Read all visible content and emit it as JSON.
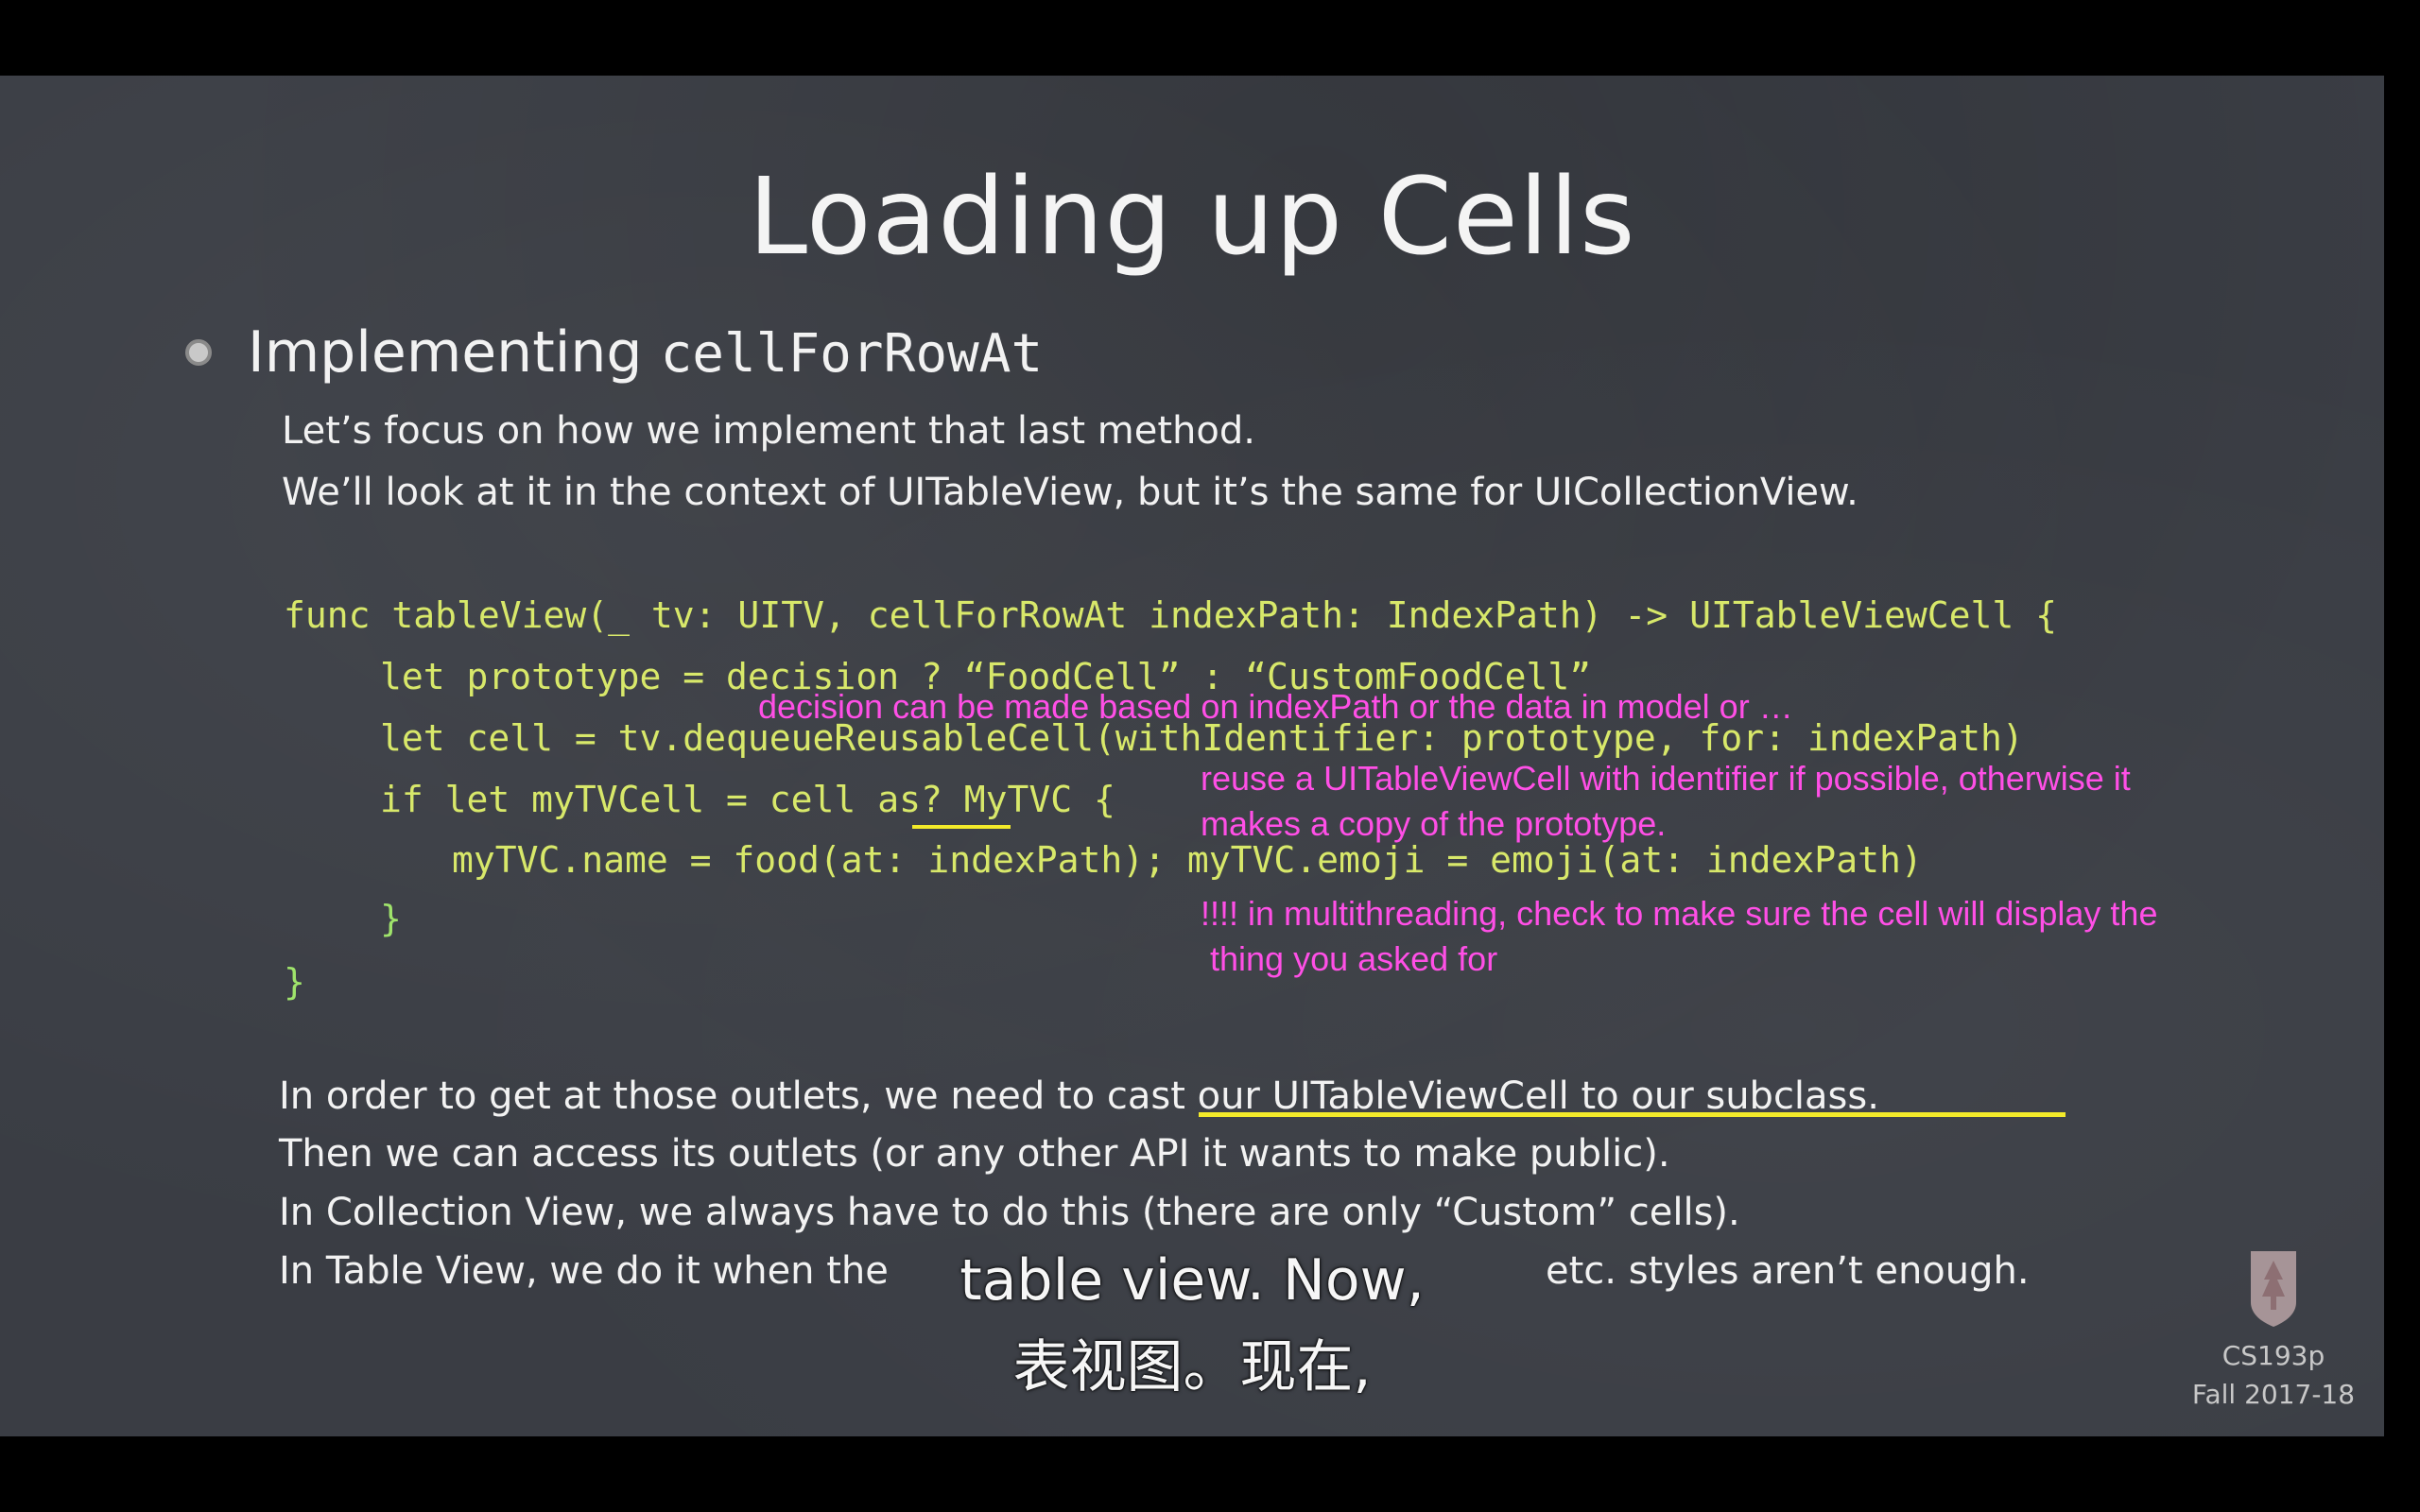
{
  "slide": {
    "title": "Loading up Cells",
    "bullet": {
      "label": "Implementing",
      "code": "cellForRowAt"
    },
    "intro": [
      "Let’s focus on how we implement that last method.",
      "We’ll look at it in the context of UITableView, but it’s the same for UICollectionView."
    ],
    "code": {
      "line1": "func tableView(_ tv: UITV, cellForRowAt indexPath: IndexPath) -> UITableViewCell {",
      "line2": "let prototype = decision ? “FoodCell” : “CustomFoodCell”",
      "line3": "let cell = tv.dequeueReusableCell(withIdentifier: prototype, for: indexPath)",
      "line4": "if let myTVCell = cell as? MyTVC {",
      "line5": "myTVC.name = food(at: indexPath); myTVC.emoji = emoji(at: indexPath)",
      "line6": "}",
      "line7": "}"
    },
    "notes": {
      "note1": "decision can be made based on indexPath or the data in model or …",
      "note2a": "reuse a UITableViewCell with identifier if possible, otherwise it",
      "note2b": "makes a copy of the prototype.",
      "note3a": "!!!! in multithreading, check to make sure the cell will display the",
      "note3b": " thing you asked for"
    },
    "outro": {
      "line1_prefix": "In order to get at those outlets, we need to ",
      "line1_emph": "cast our UITableViewCell to our subclass.",
      "line2": "Then we can access its outlets (or any other API it wants to make public).",
      "line3": "In Collection View, we always have to do this (there are only “Custom” cells).",
      "line4_a": "In Table View, we do it when the",
      "line4_b": "etc. styles aren’t enough."
    },
    "course": {
      "name": "CS193p",
      "term": "Fall 2017-18"
    }
  },
  "subtitles": {
    "english": "table view. Now,",
    "chinese": "表视图。现在,"
  },
  "colors": {
    "annotation": "#ff4fe6",
    "highlight": "#f3ea2a",
    "code": "#d8e86a",
    "background": "#3a3d44"
  }
}
